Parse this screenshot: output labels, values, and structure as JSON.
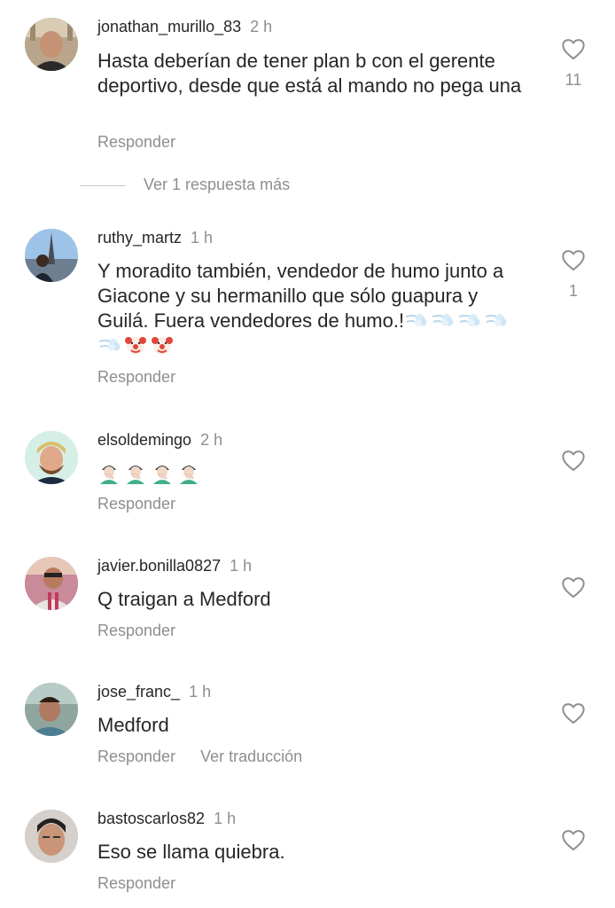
{
  "comments": [
    {
      "username": "jonathan_murillo_83",
      "time": "2 h",
      "text": "Hasta deberían de tener plan b con el gerente deportivo, desde que está al mando no pega una",
      "reply_label": "Responder",
      "likes": "11",
      "more_replies": "Ver 1 respuesta más"
    },
    {
      "username": "ruthy_martz",
      "time": "1 h",
      "text": "Y moradito también, vendedor de humo junto a Giacone y su hermanillo que sólo guapura y Guilá. Fuera vendedores  de humo.!",
      "emoji_tail": [
        "dash-emoji",
        "dash-emoji",
        "dash-emoji",
        "dash-emoji",
        "dash-emoji",
        "clown-emoji",
        "clown-emoji"
      ],
      "reply_label": "Responder",
      "likes": "1"
    },
    {
      "username": "elsoldemingo",
      "time": "2 h",
      "text": "",
      "emoji_tail": [
        "facepalm-emoji",
        "facepalm-emoji",
        "facepalm-emoji",
        "facepalm-emoji"
      ],
      "reply_label": "Responder"
    },
    {
      "username": "javier.bonilla0827",
      "time": "1 h",
      "text": "Q traigan a Medford",
      "reply_label": "Responder"
    },
    {
      "username": "jose_franc_",
      "time": "1 h",
      "text": "Medford",
      "reply_label": "Responder",
      "translate_label": "Ver traducción"
    },
    {
      "username": "bastoscarlos82",
      "time": "1 h",
      "text": "Eso se llama quiebra.",
      "reply_label": "Responder"
    }
  ],
  "colors": {
    "text": "#262626",
    "muted": "#8e8e8e",
    "background": "#ffffff"
  }
}
